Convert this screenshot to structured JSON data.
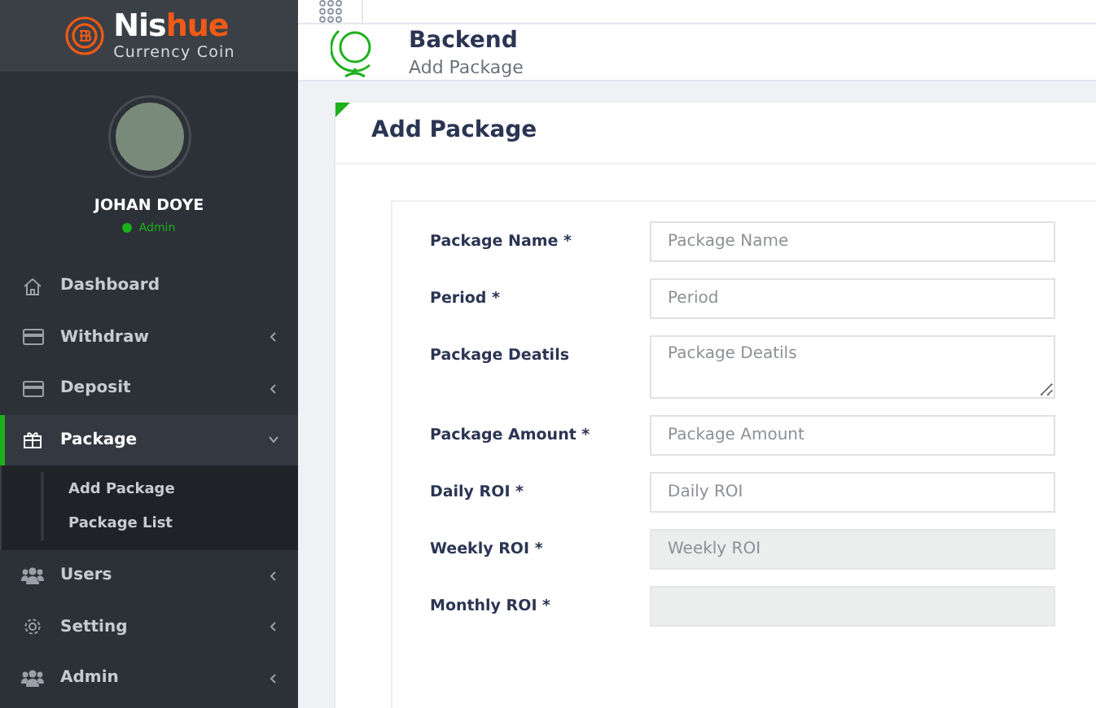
{
  "brand": {
    "name_first": "Nis",
    "name_second": "hue",
    "tagline": "Currency Coin"
  },
  "user": {
    "name": "JOHAN DOYE",
    "role": "Admin"
  },
  "sidebar": {
    "items": [
      {
        "label": "Dashboard",
        "selected": false
      },
      {
        "label": "Withdraw",
        "selected": false,
        "expanded": false
      },
      {
        "label": "Deposit",
        "selected": false,
        "expanded": false
      },
      {
        "label": "Package",
        "selected": true,
        "expanded": true,
        "children": [
          {
            "label": "Add Package"
          },
          {
            "label": "Package List"
          }
        ]
      },
      {
        "label": "Users",
        "selected": false,
        "expanded": false
      },
      {
        "label": "Setting",
        "selected": false,
        "expanded": false
      },
      {
        "label": "Admin",
        "selected": false,
        "expanded": false
      }
    ]
  },
  "header": {
    "title": "Backend",
    "subtitle": "Add Package"
  },
  "card": {
    "title": "Add Package"
  },
  "form": {
    "fields": [
      {
        "label": "Package Name *",
        "kind": "input",
        "placeholder": "Package Name",
        "disabled": false
      },
      {
        "label": "Period *",
        "kind": "input",
        "placeholder": "Period",
        "disabled": false
      },
      {
        "label": "Package Deatils",
        "kind": "textarea",
        "placeholder": "Package Deatils",
        "disabled": false
      },
      {
        "label": "Package Amount *",
        "kind": "input",
        "placeholder": "Package Amount",
        "disabled": false
      },
      {
        "label": "Daily ROI *",
        "kind": "input",
        "placeholder": "Daily ROI",
        "disabled": false
      },
      {
        "label": "Weekly ROI *",
        "kind": "input",
        "placeholder": "Weekly ROI",
        "disabled": true
      },
      {
        "label": "Monthly ROI *",
        "kind": "input",
        "disabled": true
      }
    ]
  }
}
